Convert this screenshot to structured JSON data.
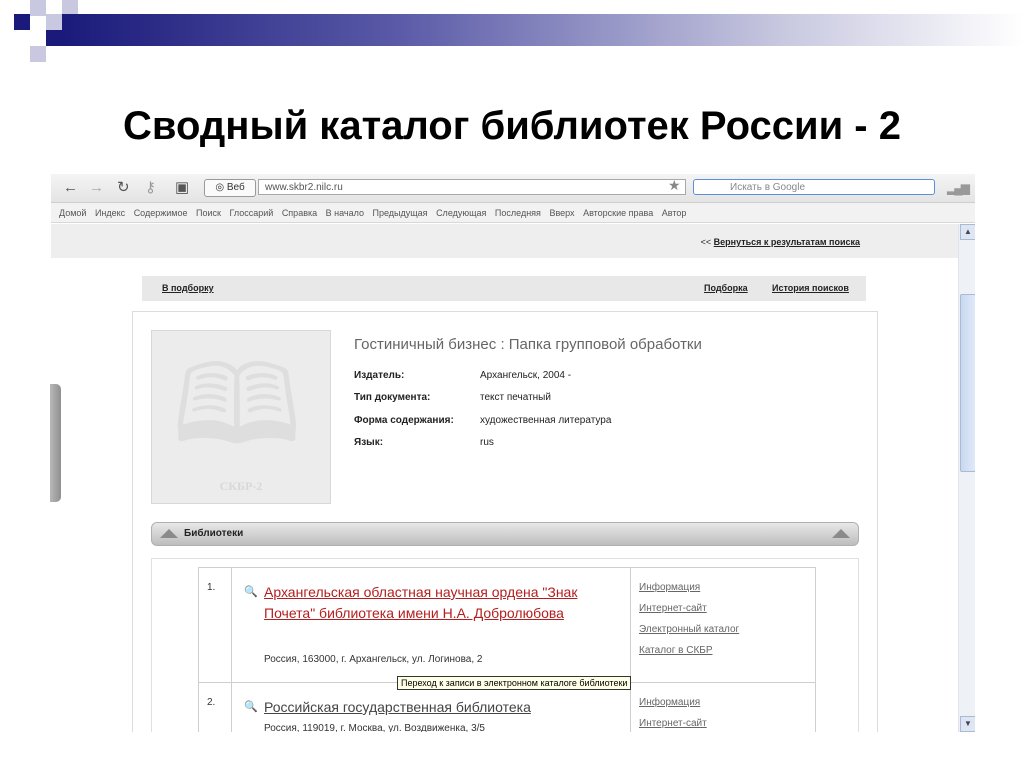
{
  "slide": {
    "title": "Сводный каталог библиотек России - 2"
  },
  "browser": {
    "web_button": "Веб",
    "url": "www.skbr2.nilc.ru",
    "search_placeholder": "Искать в Google",
    "google_letter": "8",
    "nav_items": [
      "Домой",
      "Индекс",
      "Содержимое",
      "Поиск",
      "Глоссарий",
      "Справка",
      "В начало",
      "Предыдущая",
      "Следующая",
      "Последняя",
      "Вверх",
      "Авторские права",
      "Автор"
    ]
  },
  "page": {
    "back_prefix": "<<",
    "back_link": "Вернуться к результатам поиска",
    "to_selection": "В подборку",
    "selection": "Подборка",
    "search_history": "История поисков",
    "record_title": "Гостиничный бизнес : Папка групповой обработки",
    "cover_label": "СКБР-2",
    "fields": [
      {
        "k": "Издатель:",
        "v": "Архангельск, 2004 -"
      },
      {
        "k": "Тип документа:",
        "v": "текст печатный"
      },
      {
        "k": "Форма содержания:",
        "v": "художественная литература"
      },
      {
        "k": "Язык:",
        "v": "rus"
      }
    ],
    "libraries_header": "Библиотеки",
    "libraries": [
      {
        "num": "1.",
        "name": "Архангельская областная научная ордена \"Знак Почета\" библиотека имени Н.А. Добролюбова",
        "address": "Россия, 163000, г. Архангельск, ул. Логинова, 2",
        "links": [
          "Информация",
          "Интернет-сайт",
          "Электронный каталог",
          "Каталог в СКБР"
        ]
      },
      {
        "num": "2.",
        "name": "Российская государственная библиотека",
        "address": "Россия, 119019, г. Москва, ул. Воздвиженка, 3/5",
        "links": [
          "Информация",
          "Интернет-сайт"
        ]
      }
    ],
    "tooltip": "Переход к записи в электронном каталоге библиотеки"
  }
}
